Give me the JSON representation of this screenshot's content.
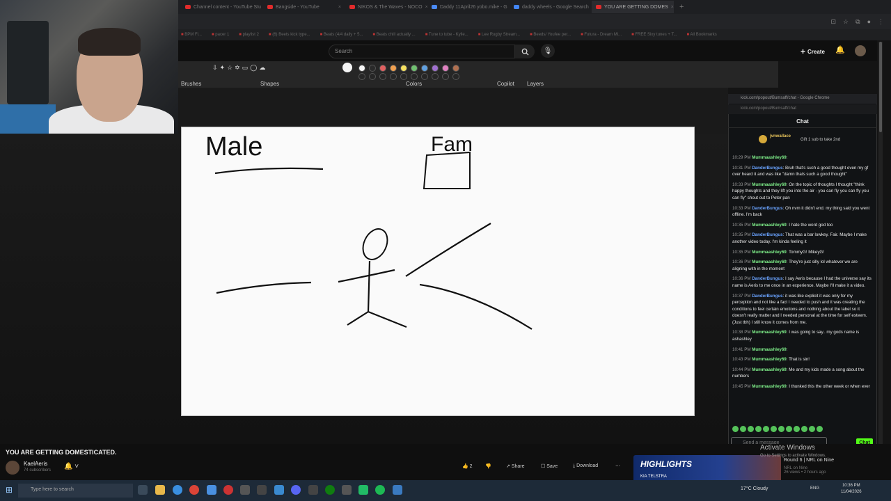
{
  "browser": {
    "tabs": [
      {
        "label": "Channel content - YouTube Stu"
      },
      {
        "label": "Bangside - YouTube"
      },
      {
        "label": "NIKOS & The Waves - NOCO"
      },
      {
        "label": "Daddy 11April26 yobo.mike - G"
      },
      {
        "label": "daddy wheels - Google Search"
      },
      {
        "label": "YOU ARE GETTING DOMES"
      }
    ],
    "bookmarks": [
      "BPM Fi...",
      "pacer 1",
      "playlist 2",
      "(6) Beets kick type...",
      "Beats (4/4 daily + 5...",
      "Beats chill actually ...",
      "Tune to tube - Kylie...",
      "Lee Rugby Stream...",
      "Beeds/ Youfee per...",
      "Futura - Dream Mi...",
      "FREE Sixy tunes + T...",
      "All Bookmarks"
    ]
  },
  "youtube": {
    "search_placeholder": "Search",
    "create_label": "Create"
  },
  "paint": {
    "labels": {
      "brushes": "Brushes",
      "shapes": "Shapes",
      "colors": "Colors",
      "copilot": "Copilot",
      "layers": "Layers"
    },
    "color_swatches": [
      "#f5f5f5",
      "#2a2a2a",
      "#e06060",
      "#f0a050",
      "#f5e060",
      "#70c070",
      "#60a0e0",
      "#a070d0",
      "#e080c0",
      "#b07050"
    ],
    "shape_icons": [
      "arrow-down-icon",
      "four-point-star-icon",
      "star-icon",
      "six-point-star-icon",
      "speech-bubble-icon",
      "speech-bubble-round-icon",
      "cloud-icon"
    ]
  },
  "drawing": {
    "text_male": "Male",
    "text_fam": "Fam"
  },
  "chat": {
    "window_title": "kick.com/popout/Bumsaff/chat - Google Chrome",
    "url": "kick.com/popout/Bumsaff/chat",
    "header": "Chat",
    "gift_user": "jvnwallace",
    "gift_text": "Gift 1 sub to take 2nd",
    "messages": [
      {
        "time": "10:29 PM",
        "user": "Mummaashley69",
        "user_class": "u1",
        "text": ":"
      },
      {
        "time": "10:31 PM",
        "user": "DanderBungus",
        "user_class": "u2",
        "text": ": Bruh that's such a good thought even my gf over heard it and was like \"damn thats such a good thought\""
      },
      {
        "time": "10:33 PM",
        "user": "Mummaashley69",
        "user_class": "u1",
        "text": ": On the topic of thoughts I thought \"think happy thoughts and they lift you into the air - you can fly you can fly you can fly\" shout out to Peter pan"
      },
      {
        "time": "10:33 PM",
        "user": "DanderBungus",
        "user_class": "u2",
        "text": ": Oh nvm it didn't end. my thing said you went offline. I'm back"
      },
      {
        "time": "10:35 PM",
        "user": "Mummaashley69",
        "user_class": "u1",
        "text": ": I hate the word god too"
      },
      {
        "time": "10:35 PM",
        "user": "DanderBungus",
        "user_class": "u2",
        "text": ": That was a bar lowkey. Fair. Maybe I make another video today. I'm kinda feeling it"
      },
      {
        "time": "10:35 PM",
        "user": "Mummaashley69",
        "user_class": "u1",
        "text": ": TommyG! MikeyG!"
      },
      {
        "time": "10:36 PM",
        "user": "Mummaashley69",
        "user_class": "u1",
        "text": ": They're just silly lol whatever we are aligning with in the moment"
      },
      {
        "time": "10:36 PM",
        "user": "DanderBungus",
        "user_class": "u2",
        "text": ": I say Aeris because I had the universe say its name is Aeris to me once in an experience. Maybe I'll make it a video."
      },
      {
        "time": "10:37 PM",
        "user": "DanderBungus",
        "user_class": "u2",
        "text": ": it was like explicit it was only for my perception and not like a fact I needed to push and it was creating the conditions to feel certain emotions and nothing about the label so it doesn't really matter and I needed personal at the time for self esteem. (Just tbh) I still know it comes from me."
      },
      {
        "time": "10:38 PM",
        "user": "Mummaashley69",
        "user_class": "u1",
        "text": ": I was going to say.. my gods name is ashashley"
      },
      {
        "time": "10:41 PM",
        "user": "Mummaashley69",
        "user_class": "u1",
        "text": ":"
      },
      {
        "time": "10:43 PM",
        "user": "Mummaashley69",
        "user_class": "u1",
        "text": ": That is sin!"
      },
      {
        "time": "10:44 PM",
        "user": "Mummaashley69",
        "user_class": "u1",
        "text": ": Me and my kids made a song about the numbers"
      },
      {
        "time": "10:45 PM",
        "user": "Mummaashley69",
        "user_class": "u1",
        "text": ": I thunked this the other week or when ever"
      }
    ],
    "input_placeholder": "Send a message",
    "send_label": "Chat"
  },
  "video": {
    "title": "YOU ARE GETTING DOMESTICATED.",
    "channel": "KaelAeris",
    "subs": "74 subscribers",
    "likes": "2",
    "share": "Share",
    "save": "Save",
    "download": "Download",
    "highlight_word": "HIGHLIGHTS",
    "highlight_brand": "KIA TELSTRA",
    "rec_title": "Round 6 | NRL on Nine",
    "rec_channel": "NRL on Nine",
    "rec_meta": "26 views • 2 hours ago"
  },
  "windows": {
    "watermark": "Activate Windows",
    "watermark_sub": "Go to Settings to activate Windows.",
    "search_placeholder": "Type here to search",
    "weather": "17°C  Cloudy",
    "lang": "ENG",
    "time": "10:36 PM",
    "date": "11/04/2026"
  }
}
